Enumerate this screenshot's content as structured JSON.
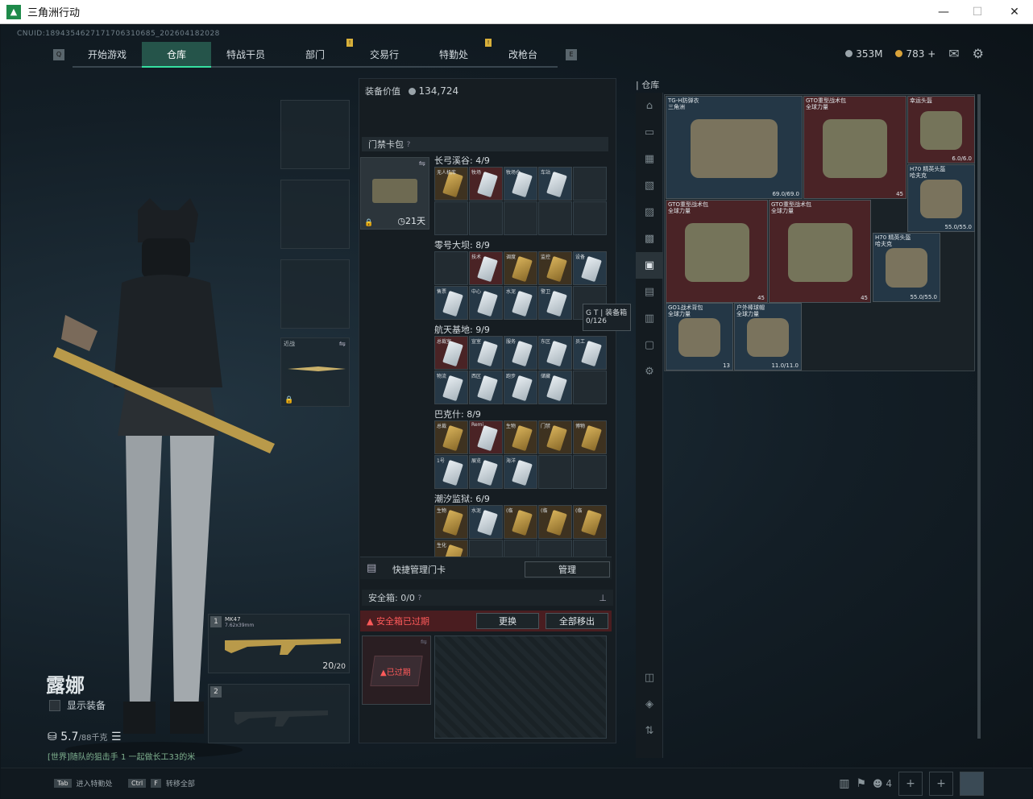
{
  "window": {
    "title": "三角洲行动",
    "minimize": "—",
    "maximize": "☐",
    "close": "✕"
  },
  "uid": "CNUID:1894354627171706310685_202604182028",
  "nav": {
    "items": [
      "开始游戏",
      "仓库",
      "特战干员",
      "部门",
      "交易行",
      "特勤处",
      "改枪台"
    ],
    "active": "仓库",
    "badges": [
      "!",
      "!"
    ],
    "left_key": "Q",
    "right_key": "E"
  },
  "currency": {
    "silver": "353M",
    "gold": "783",
    "add": "+"
  },
  "character": {
    "name": "露娜",
    "show_equipment": "显示装备",
    "weight": "5.7",
    "weight_max": "/88千克",
    "tip": "[世界]随队的狙击手 1 一起做长工33的米"
  },
  "slots": {
    "melee_label": "近战"
  },
  "weapons": {
    "slot1_num": "1",
    "slot1_name": "MK47",
    "slot1_caliber": "7.62x39mm",
    "slot1_ammo": "20",
    "slot1_ammo_max": "/20",
    "slot2_num": "2"
  },
  "panel": {
    "equip_value_label": "装备价值",
    "equip_value": "134,724",
    "card_pack_label": "门禁卡包",
    "card_pack_help": "?",
    "card_case_time": "21天",
    "regions": [
      {
        "name": "长弓溪谷: 4/9",
        "cards": [
          "无人机库",
          "牧场",
          "牧场仓",
          "车站"
        ]
      },
      {
        "name": "零号大坝: 8/9",
        "cards": [
          "",
          "技术",
          "调度",
          "监控",
          "设备",
          "售票",
          "中心",
          "水泥",
          "警卫"
        ]
      },
      {
        "name": "航天基地: 9/9",
        "cards": [
          "总裁室",
          "宣室",
          "服务",
          "东区",
          "员工",
          "物流",
          "西区",
          "跑步",
          "储藏"
        ]
      },
      {
        "name": "巴克什: 8/9",
        "cards": [
          "总裁",
          "Remi",
          "生物",
          "门禁",
          "博物",
          "1号",
          "展览",
          "海洋"
        ]
      },
      {
        "name": "潮汐监狱: 6/9",
        "cards": [
          "生物",
          "水泥",
          "(临",
          "(临",
          "(临",
          "生化"
        ]
      }
    ],
    "tooltip_title": "G T | 装备箱",
    "tooltip_value": "0/126",
    "quick_manage": "快捷管理门卡",
    "manage_button": "管理",
    "safebox_label": "安全箱: 0/0",
    "safebox_expired": "安全箱已过期",
    "replace_button": "更换",
    "move_all_button": "全部移出",
    "safebox_tag": "已过期"
  },
  "warehouse": {
    "title": "仓库",
    "items": [
      {
        "name": "TG-H防弹衣",
        "sub": "三角洲",
        "dur": "69.0/69.0"
      },
      {
        "name": "GTO重型战术包",
        "sub": "全球力量",
        "dur": "45"
      },
      {
        "name": "幸运头盔",
        "sub": "",
        "dur": "6.0/6.0"
      },
      {
        "name": "H70 精英头盔",
        "sub": "哈夫克",
        "dur": "55.0/55.0"
      },
      {
        "name": "GTO重型战术包",
        "sub": "全球力量",
        "dur": "45"
      },
      {
        "name": "GTO重型战术包",
        "sub": "全球力量",
        "dur": "45"
      },
      {
        "name": "H70 精英头盔",
        "sub": "哈夫克",
        "dur": "55.0/55.0"
      },
      {
        "name": "GO1战术背包",
        "sub": "全球力量",
        "dur": "13"
      },
      {
        "name": "户外棒球帽",
        "sub": "全球力量",
        "dur": "11.0/11.0"
      }
    ]
  },
  "bottom": {
    "tab_key": "Tab",
    "tab_label": "进入特勤处",
    "ctrl_key": "Ctrl",
    "f_key": "F",
    "ctrl_label": "转移全部",
    "squad_count": "4"
  }
}
